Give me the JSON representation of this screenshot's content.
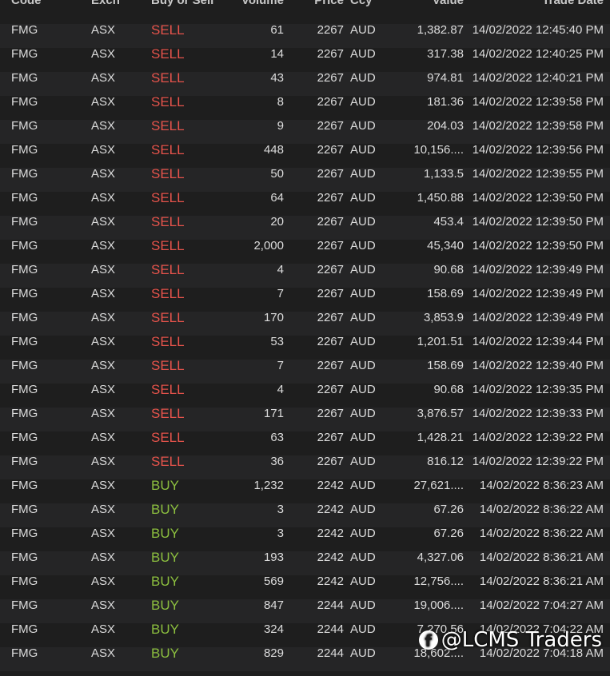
{
  "columns": {
    "code": "Code",
    "exch": "Exch",
    "side": "Buy or Sell",
    "volume": "Volume",
    "price": "Price",
    "ccy": "Ccy",
    "value": "Value",
    "date": "Trade Date"
  },
  "rows": [
    {
      "code": "FMG",
      "exch": "ASX",
      "side": "SELL",
      "volume": "61",
      "price": "2267",
      "ccy": "AUD",
      "value": "1,382.87",
      "date": "14/02/2022 12:45:40 PM"
    },
    {
      "code": "FMG",
      "exch": "ASX",
      "side": "SELL",
      "volume": "14",
      "price": "2267",
      "ccy": "AUD",
      "value": "317.38",
      "date": "14/02/2022 12:40:25 PM"
    },
    {
      "code": "FMG",
      "exch": "ASX",
      "side": "SELL",
      "volume": "43",
      "price": "2267",
      "ccy": "AUD",
      "value": "974.81",
      "date": "14/02/2022 12:40:21 PM"
    },
    {
      "code": "FMG",
      "exch": "ASX",
      "side": "SELL",
      "volume": "8",
      "price": "2267",
      "ccy": "AUD",
      "value": "181.36",
      "date": "14/02/2022 12:39:58 PM"
    },
    {
      "code": "FMG",
      "exch": "ASX",
      "side": "SELL",
      "volume": "9",
      "price": "2267",
      "ccy": "AUD",
      "value": "204.03",
      "date": "14/02/2022 12:39:58 PM"
    },
    {
      "code": "FMG",
      "exch": "ASX",
      "side": "SELL",
      "volume": "448",
      "price": "2267",
      "ccy": "AUD",
      "value": "10,156....",
      "date": "14/02/2022 12:39:56 PM"
    },
    {
      "code": "FMG",
      "exch": "ASX",
      "side": "SELL",
      "volume": "50",
      "price": "2267",
      "ccy": "AUD",
      "value": "1,133.5",
      "date": "14/02/2022 12:39:55 PM"
    },
    {
      "code": "FMG",
      "exch": "ASX",
      "side": "SELL",
      "volume": "64",
      "price": "2267",
      "ccy": "AUD",
      "value": "1,450.88",
      "date": "14/02/2022 12:39:50 PM"
    },
    {
      "code": "FMG",
      "exch": "ASX",
      "side": "SELL",
      "volume": "20",
      "price": "2267",
      "ccy": "AUD",
      "value": "453.4",
      "date": "14/02/2022 12:39:50 PM"
    },
    {
      "code": "FMG",
      "exch": "ASX",
      "side": "SELL",
      "volume": "2,000",
      "price": "2267",
      "ccy": "AUD",
      "value": "45,340",
      "date": "14/02/2022 12:39:50 PM"
    },
    {
      "code": "FMG",
      "exch": "ASX",
      "side": "SELL",
      "volume": "4",
      "price": "2267",
      "ccy": "AUD",
      "value": "90.68",
      "date": "14/02/2022 12:39:49 PM"
    },
    {
      "code": "FMG",
      "exch": "ASX",
      "side": "SELL",
      "volume": "7",
      "price": "2267",
      "ccy": "AUD",
      "value": "158.69",
      "date": "14/02/2022 12:39:49 PM"
    },
    {
      "code": "FMG",
      "exch": "ASX",
      "side": "SELL",
      "volume": "170",
      "price": "2267",
      "ccy": "AUD",
      "value": "3,853.9",
      "date": "14/02/2022 12:39:49 PM"
    },
    {
      "code": "FMG",
      "exch": "ASX",
      "side": "SELL",
      "volume": "53",
      "price": "2267",
      "ccy": "AUD",
      "value": "1,201.51",
      "date": "14/02/2022 12:39:44 PM"
    },
    {
      "code": "FMG",
      "exch": "ASX",
      "side": "SELL",
      "volume": "7",
      "price": "2267",
      "ccy": "AUD",
      "value": "158.69",
      "date": "14/02/2022 12:39:40 PM"
    },
    {
      "code": "FMG",
      "exch": "ASX",
      "side": "SELL",
      "volume": "4",
      "price": "2267",
      "ccy": "AUD",
      "value": "90.68",
      "date": "14/02/2022 12:39:35 PM"
    },
    {
      "code": "FMG",
      "exch": "ASX",
      "side": "SELL",
      "volume": "171",
      "price": "2267",
      "ccy": "AUD",
      "value": "3,876.57",
      "date": "14/02/2022 12:39:33 PM"
    },
    {
      "code": "FMG",
      "exch": "ASX",
      "side": "SELL",
      "volume": "63",
      "price": "2267",
      "ccy": "AUD",
      "value": "1,428.21",
      "date": "14/02/2022 12:39:22 PM"
    },
    {
      "code": "FMG",
      "exch": "ASX",
      "side": "SELL",
      "volume": "36",
      "price": "2267",
      "ccy": "AUD",
      "value": "816.12",
      "date": "14/02/2022 12:39:22 PM"
    },
    {
      "code": "FMG",
      "exch": "ASX",
      "side": "BUY",
      "volume": "1,232",
      "price": "2242",
      "ccy": "AUD",
      "value": "27,621....",
      "date": "14/02/2022 8:36:23 AM"
    },
    {
      "code": "FMG",
      "exch": "ASX",
      "side": "BUY",
      "volume": "3",
      "price": "2242",
      "ccy": "AUD",
      "value": "67.26",
      "date": "14/02/2022 8:36:22 AM"
    },
    {
      "code": "FMG",
      "exch": "ASX",
      "side": "BUY",
      "volume": "3",
      "price": "2242",
      "ccy": "AUD",
      "value": "67.26",
      "date": "14/02/2022 8:36:22 AM"
    },
    {
      "code": "FMG",
      "exch": "ASX",
      "side": "BUY",
      "volume": "193",
      "price": "2242",
      "ccy": "AUD",
      "value": "4,327.06",
      "date": "14/02/2022 8:36:21 AM"
    },
    {
      "code": "FMG",
      "exch": "ASX",
      "side": "BUY",
      "volume": "569",
      "price": "2242",
      "ccy": "AUD",
      "value": "12,756....",
      "date": "14/02/2022 8:36:21 AM"
    },
    {
      "code": "FMG",
      "exch": "ASX",
      "side": "BUY",
      "volume": "847",
      "price": "2244",
      "ccy": "AUD",
      "value": "19,006....",
      "date": "14/02/2022 7:04:27 AM"
    },
    {
      "code": "FMG",
      "exch": "ASX",
      "side": "BUY",
      "volume": "324",
      "price": "2244",
      "ccy": "AUD",
      "value": "7,270.56",
      "date": "14/02/2022 7:04:22 AM"
    },
    {
      "code": "FMG",
      "exch": "ASX",
      "side": "BUY",
      "volume": "829",
      "price": "2244",
      "ccy": "AUD",
      "value": "18,602....",
      "date": "14/02/2022 7:04:18 AM"
    }
  ],
  "watermark": {
    "icon": "facebook-icon",
    "glyph": "f",
    "text": "@LCMS Traders"
  },
  "colors": {
    "sell": "#e5534b",
    "buy": "#8cbf3f",
    "background": "#1e1e1e",
    "row_alt": "#252526"
  }
}
